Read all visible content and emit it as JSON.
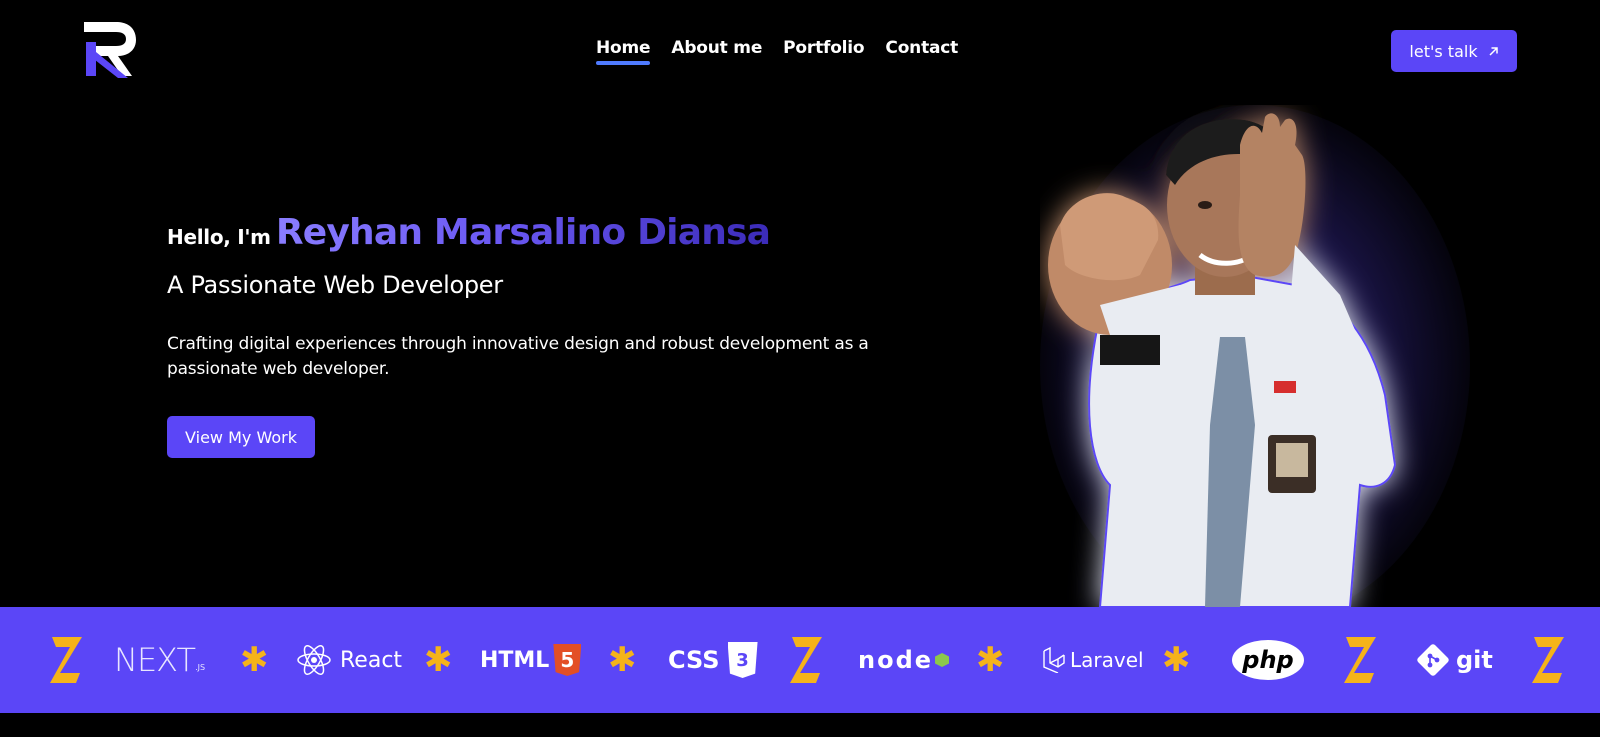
{
  "header": {
    "nav": [
      {
        "label": "Home",
        "active": true
      },
      {
        "label": "About me",
        "active": false
      },
      {
        "label": "Portfolio",
        "active": false
      },
      {
        "label": "Contact",
        "active": false
      }
    ],
    "talk_label": "let's talk",
    "talk_icon": "arrow-up-right-icon"
  },
  "hero": {
    "greeting": "Hello, I'm",
    "name": "Reyhan Marsalino Diansa",
    "subtitle": "A Passionate Web Developer",
    "description": "Crafting digital experiences through innovative design and robust development as a passionate web developer.",
    "cta_label": "View My Work"
  },
  "tech_strip": {
    "items": [
      "django-logo",
      "nextjs-logo",
      "asterisk",
      "react-logo",
      "asterisk",
      "html5-logo",
      "asterisk",
      "css3-logo",
      "django-logo",
      "nodejs-logo",
      "asterisk",
      "laravel-logo",
      "asterisk",
      "php-logo",
      "django-logo",
      "git-logo",
      "django-logo"
    ],
    "labels": {
      "next": "NEXT",
      "next_suffix": ".JS",
      "react": "React",
      "html": "HTML",
      "html_badge": "5",
      "css": "CSS",
      "css_badge": "3",
      "node": "node",
      "laravel": "Laravel",
      "php": "php",
      "git": "git"
    }
  },
  "colors": {
    "accent": "#5b46f7",
    "nav_underline": "#4f7bff",
    "asterisk": "#f5b31a",
    "background": "#000000"
  }
}
